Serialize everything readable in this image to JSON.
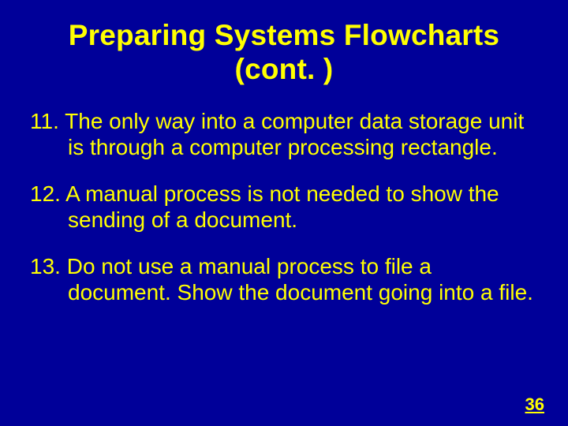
{
  "title_line1": "Preparing Systems Flowcharts",
  "title_line2": "(cont. )",
  "items": [
    {
      "num": "11.",
      "text": "The only way into a computer data storage unit is through a computer processing rectangle."
    },
    {
      "num": "12.",
      "text": "A manual process is not needed to show the sending of a document."
    },
    {
      "num": "13.",
      "text": "Do not use a manual process to file a document. Show the document going into a file."
    }
  ],
  "page_number": "36"
}
